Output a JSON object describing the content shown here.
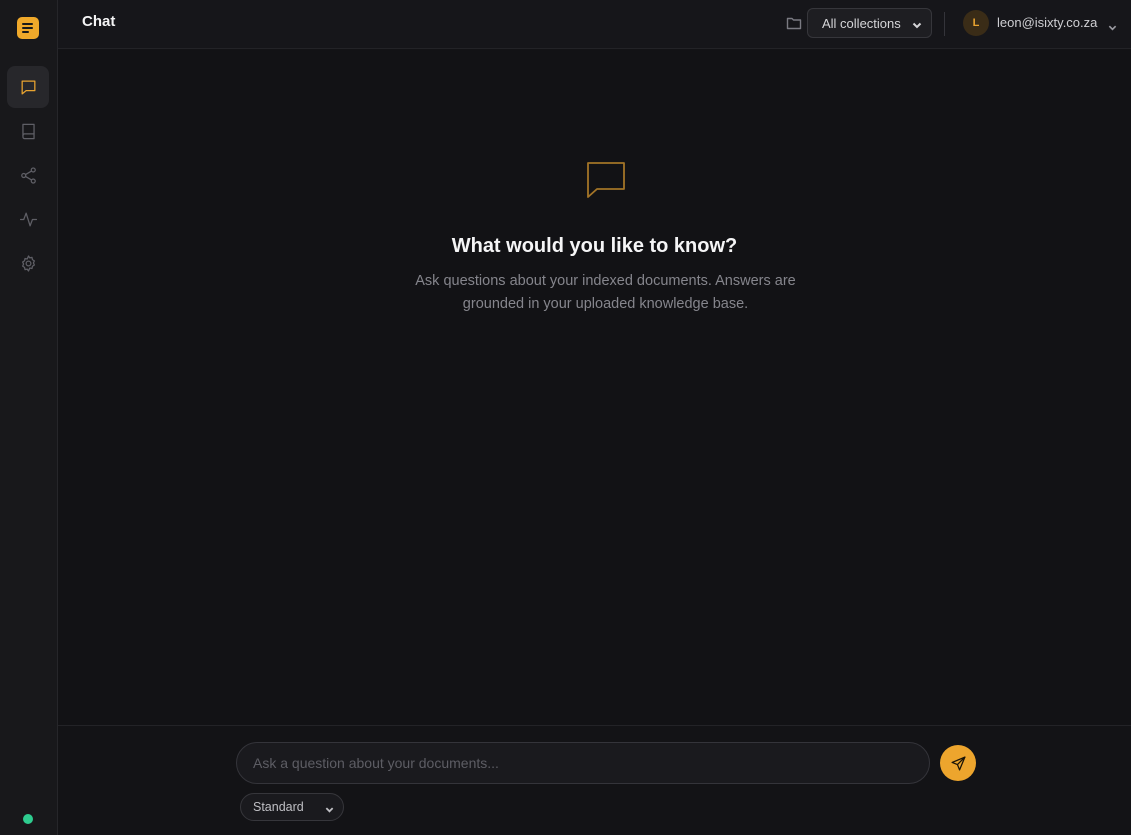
{
  "sidebar": {
    "logo_icon": "notes-icon",
    "items": [
      {
        "icon": "chat-icon",
        "active": true
      },
      {
        "icon": "book-icon",
        "active": false
      },
      {
        "icon": "share-graph-icon",
        "active": false
      },
      {
        "icon": "activity-icon",
        "active": false
      },
      {
        "icon": "settings-gear-icon",
        "active": false
      }
    ],
    "status_color": "#2ecc8f"
  },
  "header": {
    "title": "Chat",
    "collections_select": "All collections",
    "user": {
      "initial": "L",
      "email": "leon@isixty.co.za"
    }
  },
  "empty_state": {
    "title": "What would you like to know?",
    "description": "Ask questions about your indexed documents. Answers are grounded in your uploaded knowledge base."
  },
  "composer": {
    "placeholder": "Ask a question about your documents...",
    "value": "",
    "mode": "Standard"
  },
  "colors": {
    "accent": "#eda52d",
    "background": "#131316",
    "sidebar": "#18181b"
  }
}
